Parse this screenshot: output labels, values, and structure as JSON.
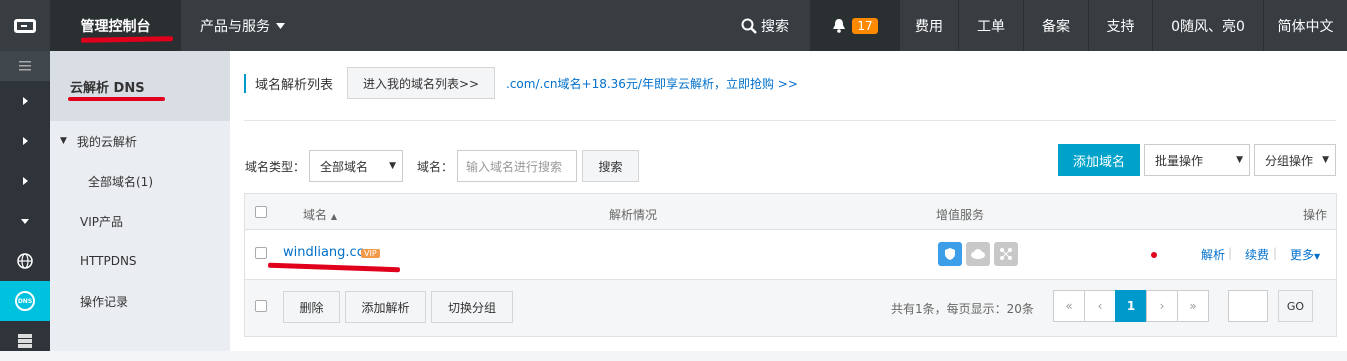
{
  "topbar": {
    "logo_icon": "aliyun-logo-icon",
    "console": "管理控制台",
    "products": "产品与服务",
    "search": "搜索",
    "notify_count": "17",
    "fees": "费用",
    "tickets": "工单",
    "record": "备案",
    "support": "支持",
    "user": "0随风、亮0",
    "lang": "简体中文"
  },
  "sidebar_dark": {
    "icons": [
      "menu-icon",
      "chevron-right-icon",
      "chevron-right-icon",
      "chevron-right-icon",
      "chevron-down-icon",
      "globe-icon",
      "dns-icon",
      "server-icon"
    ],
    "dns_label": "DNS"
  },
  "subnav": {
    "title": "云解析 DNS",
    "group": "我的云解析",
    "all_domains": "全部域名(1)",
    "vip": "VIP产品",
    "httpdns": "HTTPDNS",
    "log": "操作记录"
  },
  "main": {
    "list_title": "域名解析列表",
    "enter_list_btn": "进入我的域名列表>>",
    "promo": ".com/.cn域名+18.36元/年即享云解析，立即抢购 >>",
    "filter": {
      "type_label": "域名类型：",
      "type_value": "全部域名",
      "domain_label": "域名：",
      "domain_placeholder": "输入域名进行搜索",
      "search_btn": "搜索",
      "add_btn": "添加域名",
      "batch": "批量操作",
      "group": "分组操作"
    },
    "table": {
      "headers": {
        "domain": "域名",
        "status": "解析情况",
        "service": "增值服务",
        "ops": "操作"
      },
      "rows": [
        {
          "domain": "windliang.cc",
          "badge": "VIP",
          "resolve": "解析",
          "renew": "续费",
          "more": "更多"
        }
      ],
      "footer": {
        "delete": "删除",
        "add_record": "添加解析",
        "switch_group": "切换分组",
        "summary": "共有1条，每页显示：20条",
        "pages": [
          "«",
          "‹",
          "1",
          "›",
          "»"
        ],
        "go": "GO"
      }
    }
  },
  "colors": {
    "topbar": "#373d41",
    "accent": "#00a2ca",
    "link": "#0070cc",
    "annotation": "#e0001b",
    "vip": "#f29a4a"
  }
}
